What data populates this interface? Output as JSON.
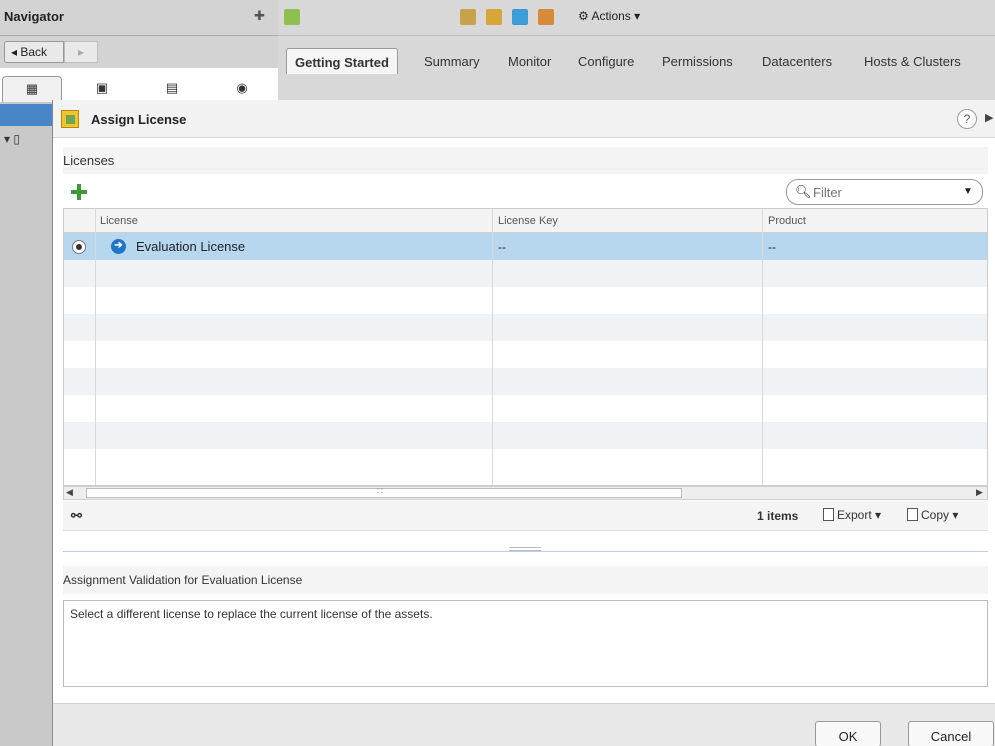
{
  "navigator": {
    "title": "Navigator",
    "back_label": "◂ Back",
    "forward_label": "▸"
  },
  "toolbar": {
    "actions_label": "Actions ▾"
  },
  "tabs": [
    {
      "label": "Getting Started",
      "active": true
    },
    {
      "label": "Summary"
    },
    {
      "label": "Monitor"
    },
    {
      "label": "Configure"
    },
    {
      "label": "Permissions"
    },
    {
      "label": "Datacenters"
    },
    {
      "label": "Hosts & Clusters"
    }
  ],
  "dialog": {
    "title": "Assign License",
    "help_label": "?",
    "licenses_section": "Licenses",
    "filter_placeholder": "Filter",
    "columns": [
      "License",
      "License Key",
      "Product"
    ],
    "rows": [
      {
        "license": "Evaluation License",
        "license_key": "--",
        "product": "--",
        "selected": true
      }
    ],
    "items_count": "1 items",
    "export_label": "Export ▾",
    "copy_label": "Copy ▾",
    "validation_title": "Assignment Validation for Evaluation License",
    "validation_text": "Select a different license to replace the current license of the assets.",
    "ok_label": "OK",
    "cancel_label": "Cancel"
  },
  "colors": {
    "selected_row": "#b7d7ef",
    "add_green": "#3c9a3c",
    "arrow_blue": "#1f74c9"
  }
}
